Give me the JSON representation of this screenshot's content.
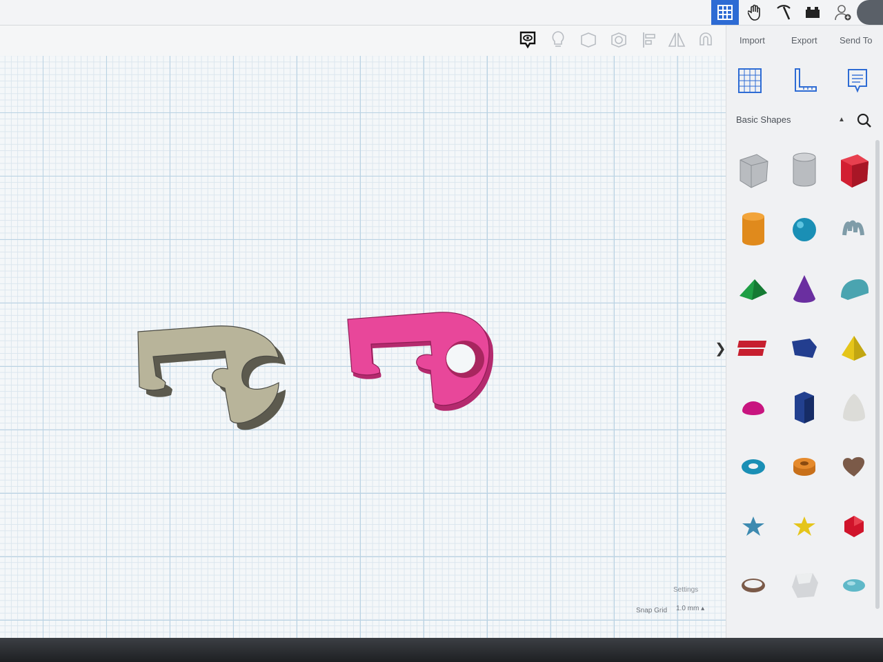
{
  "topbar": {
    "buttons": [
      {
        "name": "grid-view",
        "icon": "grid-icon",
        "active": true
      },
      {
        "name": "hand",
        "icon": "hand-icon"
      },
      {
        "name": "pickaxe",
        "icon": "pickaxe-icon"
      },
      {
        "name": "blocks",
        "icon": "bricks-icon"
      },
      {
        "name": "add-user",
        "icon": "add-user-icon"
      }
    ]
  },
  "toolbar": {
    "tools": [
      {
        "name": "notes",
        "icon": "speech-eye-icon"
      },
      {
        "name": "light",
        "icon": "lightbulb-icon"
      },
      {
        "name": "shape",
        "icon": "shape-icon"
      },
      {
        "name": "hole",
        "icon": "hole-icon"
      },
      {
        "name": "align",
        "icon": "align-icon"
      },
      {
        "name": "mirror",
        "icon": "mirror-icon"
      },
      {
        "name": "magnet",
        "icon": "magnet-icon"
      }
    ]
  },
  "panel": {
    "import_label": "Import",
    "export_label": "Export",
    "send_to_label": "Send To",
    "category": "Basic Shapes"
  },
  "workplane": {
    "settings_label": "Settings",
    "snap_label": "Snap Grid",
    "snap_value": "1.0 mm ▴"
  },
  "colors": {
    "accent": "#2d6bd4",
    "shape_tan": "#b8b49a",
    "shape_pink": "#e8479a"
  },
  "shape_library": [
    "box-hole",
    "cylinder-hole",
    "box",
    "cylinder",
    "sphere",
    "scribble",
    "roof",
    "cone",
    "round-roof",
    "text",
    "polygon",
    "pyramid",
    "half-sphere",
    "hexagonal-prism",
    "paraboloid",
    "torus",
    "tube",
    "heart",
    "star",
    "star-gold",
    "icosahedron",
    "ring",
    "gem",
    "ellipsoid"
  ]
}
